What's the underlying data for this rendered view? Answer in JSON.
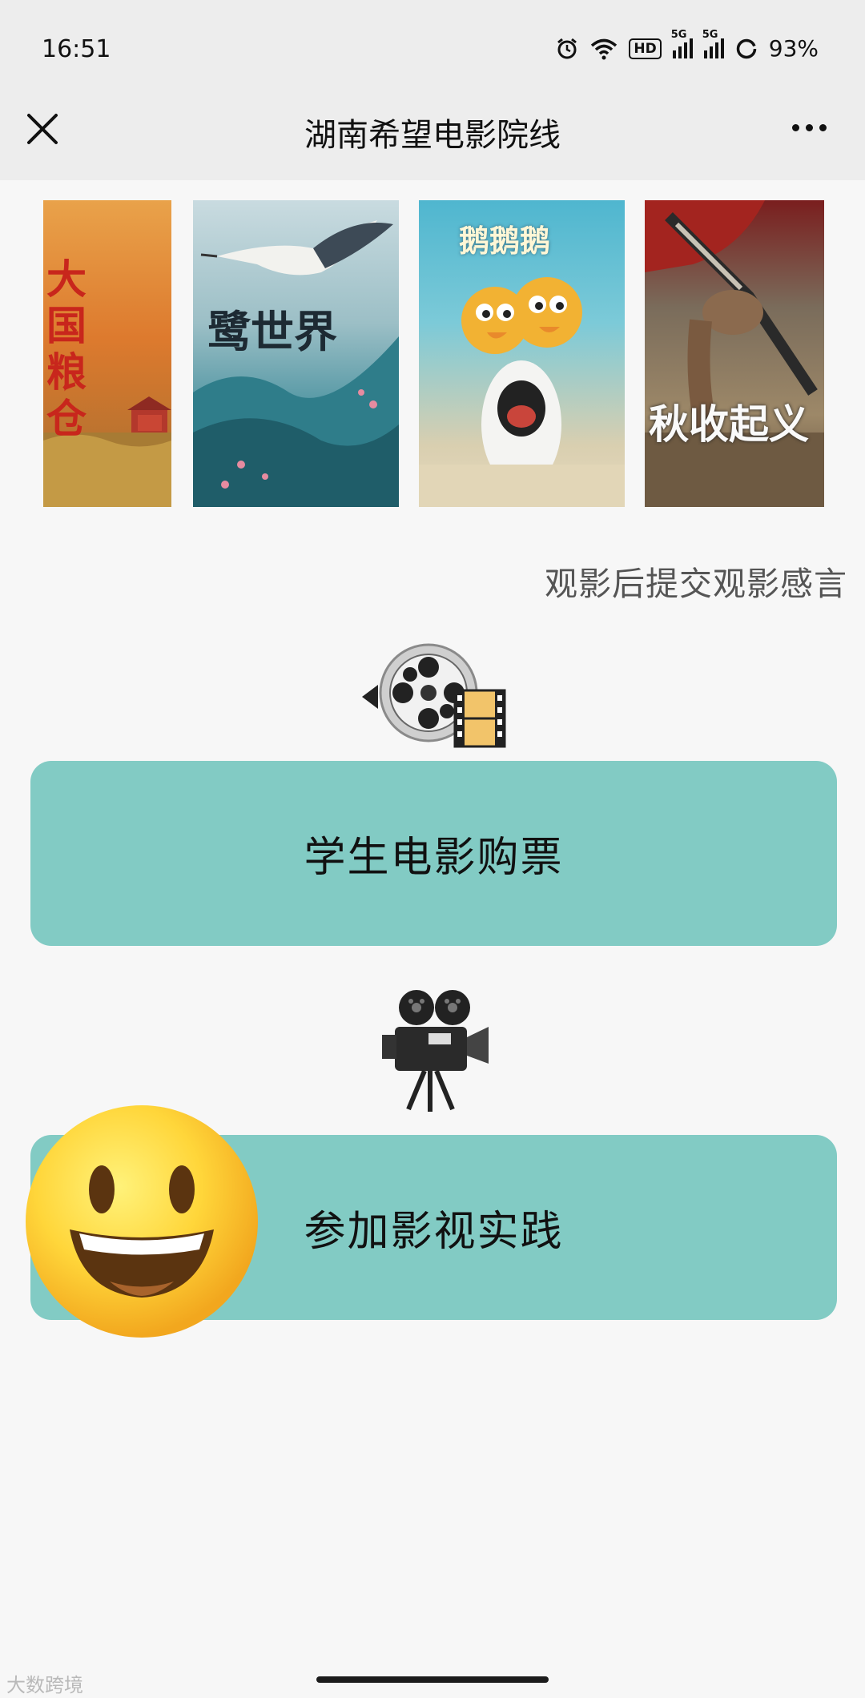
{
  "status_bar": {
    "time": "16:51",
    "hd_label": "HD",
    "signal_1_label": "5G",
    "signal_2_label": "5G",
    "battery": "93%"
  },
  "nav": {
    "title": "湖南希望电影院线",
    "close_icon": "close-icon",
    "more_icon": "more-icon"
  },
  "posters": [
    {
      "title": "大国粮仓"
    },
    {
      "title": "鹭世界"
    },
    {
      "title": "鹅鹅鹅"
    },
    {
      "title": "秋收起义"
    }
  ],
  "reviews_link": "观影后提交观影感言",
  "buttons": {
    "ticket": "学生电影购票",
    "practice": "参加影视实践"
  },
  "watermark": "大数跨境",
  "colors": {
    "button_bg": "#82cbc4",
    "header_bg": "#ededed",
    "page_bg": "#f7f7f7"
  }
}
